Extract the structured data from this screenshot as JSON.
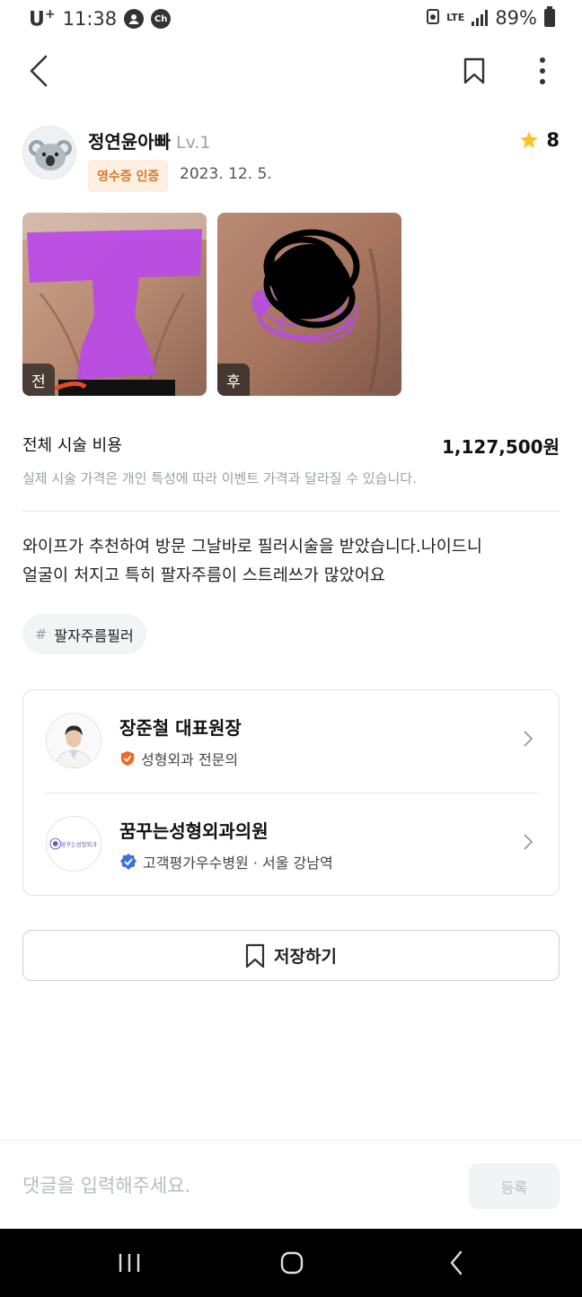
{
  "status_bar": {
    "carrier": "U",
    "carrier_sup": "+",
    "time": "11:38",
    "chat_badge": "Ch",
    "network": "LTE",
    "battery": "89%"
  },
  "header": {
    "back_icon": "chevron-left-icon",
    "bookmark_icon": "bookmark-icon",
    "more_icon": "more-vertical-icon"
  },
  "author": {
    "name": "정연윤아빠",
    "level": "Lv.1",
    "badge": "영수증 인증",
    "date": "2023. 12. 5.",
    "rating": "8"
  },
  "photos": [
    {
      "tag": "전"
    },
    {
      "tag": "후"
    }
  ],
  "cost": {
    "label": "전체 시술 비용",
    "value": "1,127,500원",
    "note": "실제 시술 가격은 개인 특성에 따라 이벤트 가격과 달라질 수 있습니다."
  },
  "review": {
    "line1": "와이프가 추천하여 방문 그날바로 필러시술을 받았습니다.나이드니",
    "line2": "얼굴이 처지고 특히 팔자주름이 스트레쓰가 많았어요"
  },
  "hashtag": {
    "hash": "#",
    "label": "팔자주름필러"
  },
  "doctor": {
    "name": "장준철 대표원장",
    "specialty": "성형외과 전문의"
  },
  "hospital": {
    "name": "꿈꾸는성형외과의원",
    "info": "고객평가우수병원 · 서울 강남역",
    "logo_text": "꿈꾸는성형외과"
  },
  "save_button": {
    "label": "저장하기"
  },
  "comment": {
    "placeholder": "댓글을 입력해주세요.",
    "submit_label": "등록"
  },
  "colors": {
    "accent_orange": "#f06a27",
    "badge_bg": "#fdf0e1",
    "badge_text": "#d47a2a",
    "verified_blue": "#3f6fe0",
    "star": "#f7c325",
    "scribble_purple": "#b94be6"
  }
}
